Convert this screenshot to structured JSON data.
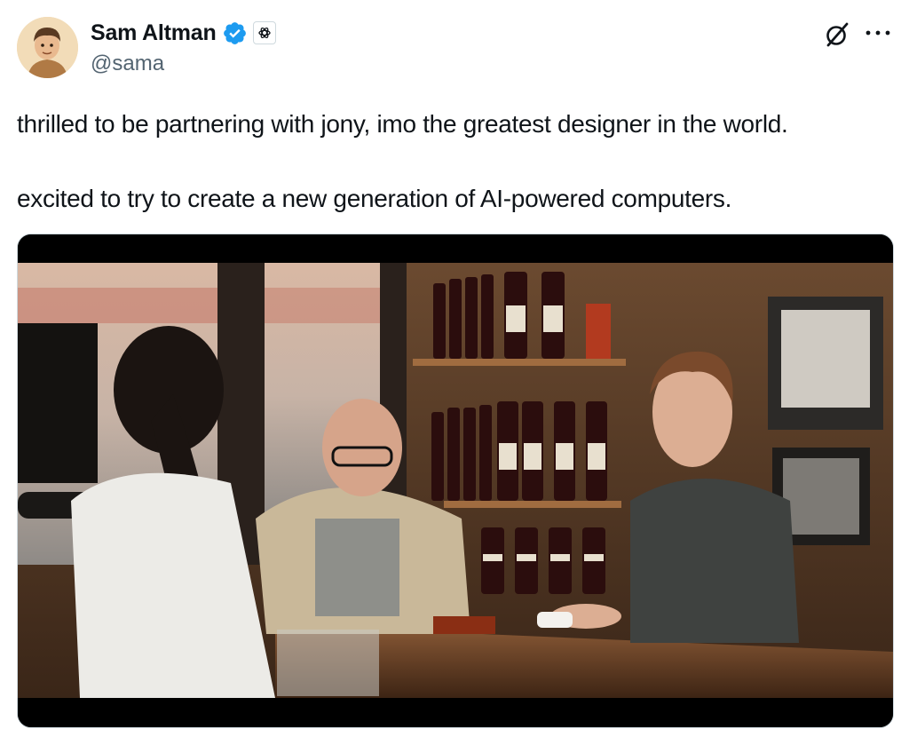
{
  "author": {
    "display_name": "Sam Altman",
    "handle": "@sama",
    "verified": true,
    "verified_color": "#1d9bf0",
    "affiliate_badge_icon": "openai-logo-icon",
    "avatar_icon": "cartoon-avatar-icon"
  },
  "actions": {
    "grok_icon": "grok-icon",
    "more_icon": "more-dots-icon"
  },
  "tweet": {
    "paragraphs": [
      "thrilled to be partnering with jony, imo the greatest designer in the world.",
      "excited to try to create a new generation of AI-powered computers."
    ]
  },
  "media": {
    "kind": "video-still"
  }
}
